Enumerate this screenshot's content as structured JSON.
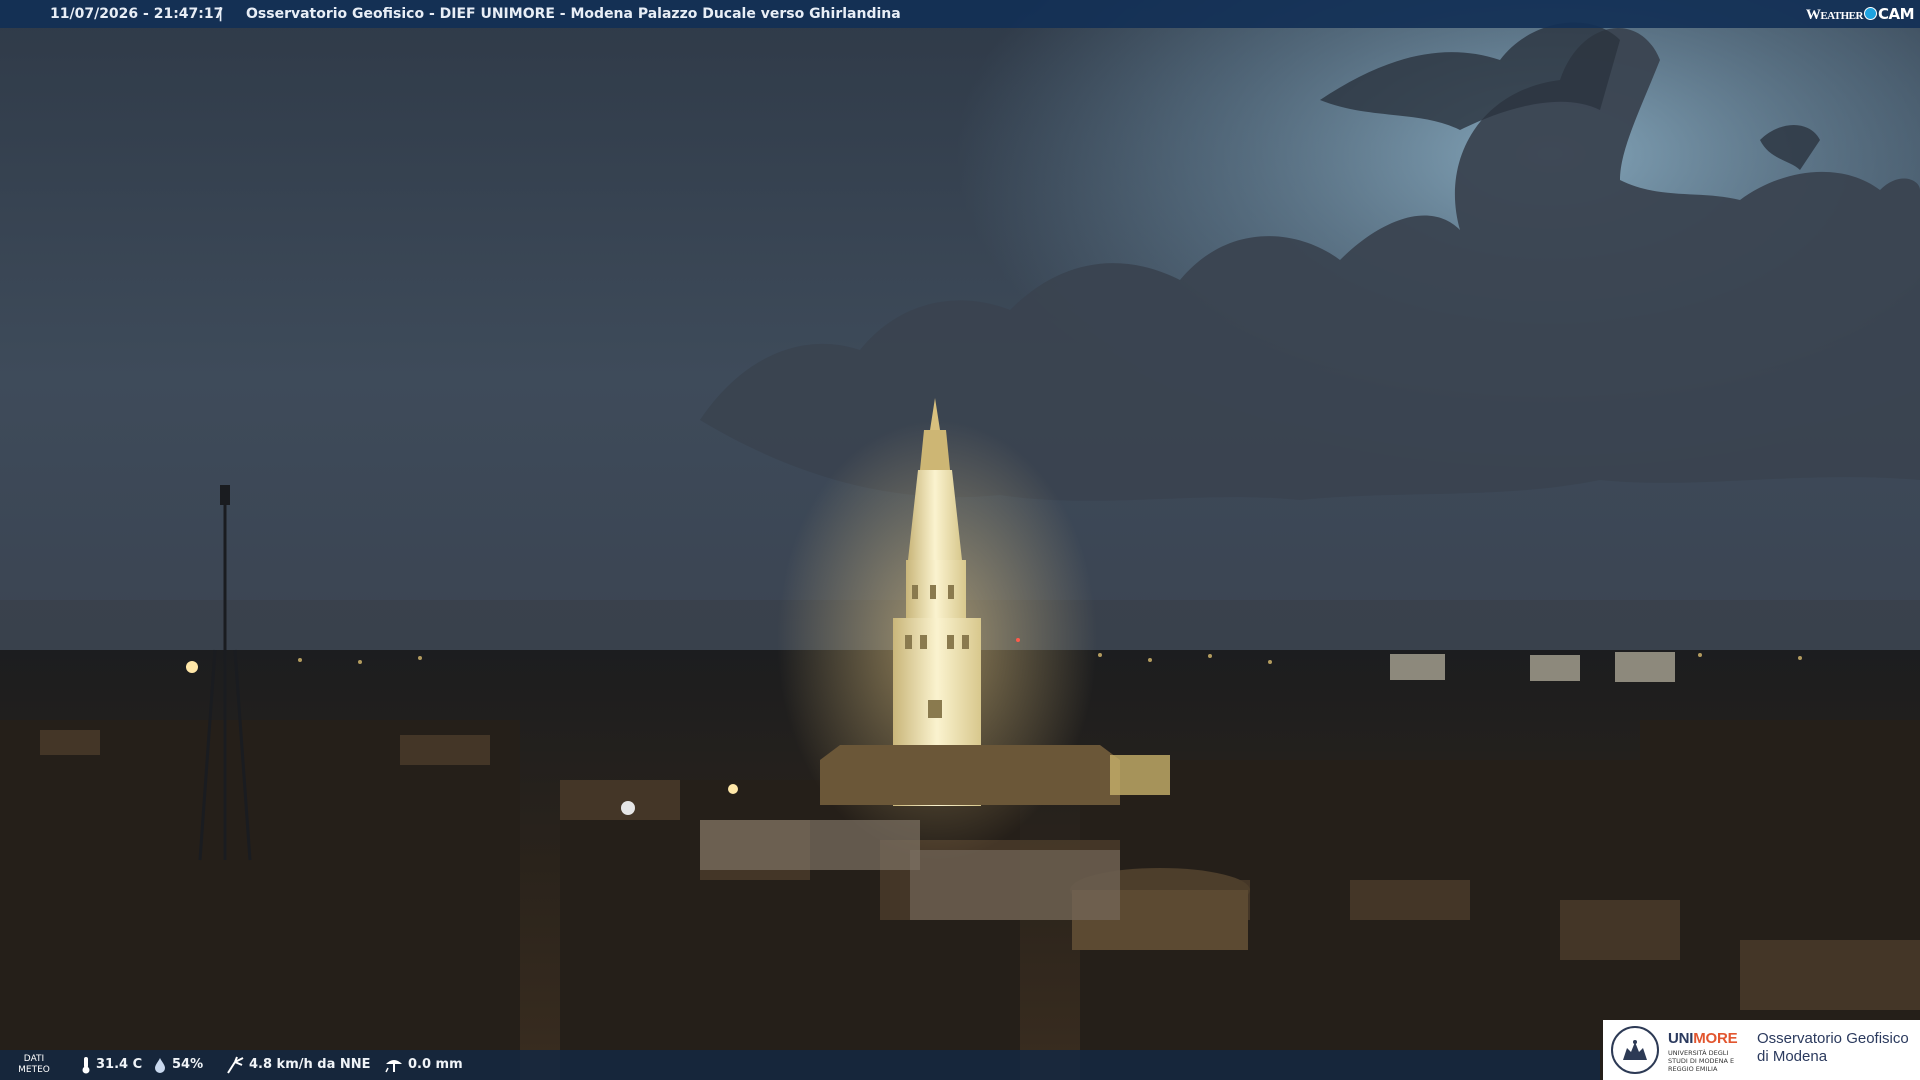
{
  "overlay": {
    "timestamp": "11/07/2026 - 21:47:17",
    "separator": "|",
    "title": "Osservatorio Geofisico - DIEF UNIMORE - Modena Palazzo Ducale verso Ghirlandina",
    "brand_left": "Weather",
    "brand_right": "CAM"
  },
  "meteo": {
    "label_line1": "DATI",
    "label_line2": "METEO",
    "temperature": "31.4 C",
    "temperature_icon": "thermometer-icon",
    "humidity": "54%",
    "humidity_icon": "humidity-drop-icon",
    "wind": "4.8 km/h da NNE",
    "wind_icon": "wind-icon",
    "rain": "0.0 mm",
    "rain_icon": "rain-gauge-icon"
  },
  "logo": {
    "uni_part1": "UNI",
    "uni_part2": "MORE",
    "uni_sub": "UNIVERSITÀ DEGLI STUDI DI MODENA E REGGIO EMILIA",
    "obs_line1": "Osservatorio Geofisico",
    "obs_line2": "di Modena"
  },
  "colors": {
    "bar": "#123056",
    "accent_more": "#e2562f",
    "brand_dot": "#1fa3e0",
    "tower_light": "#f3e6b0"
  }
}
